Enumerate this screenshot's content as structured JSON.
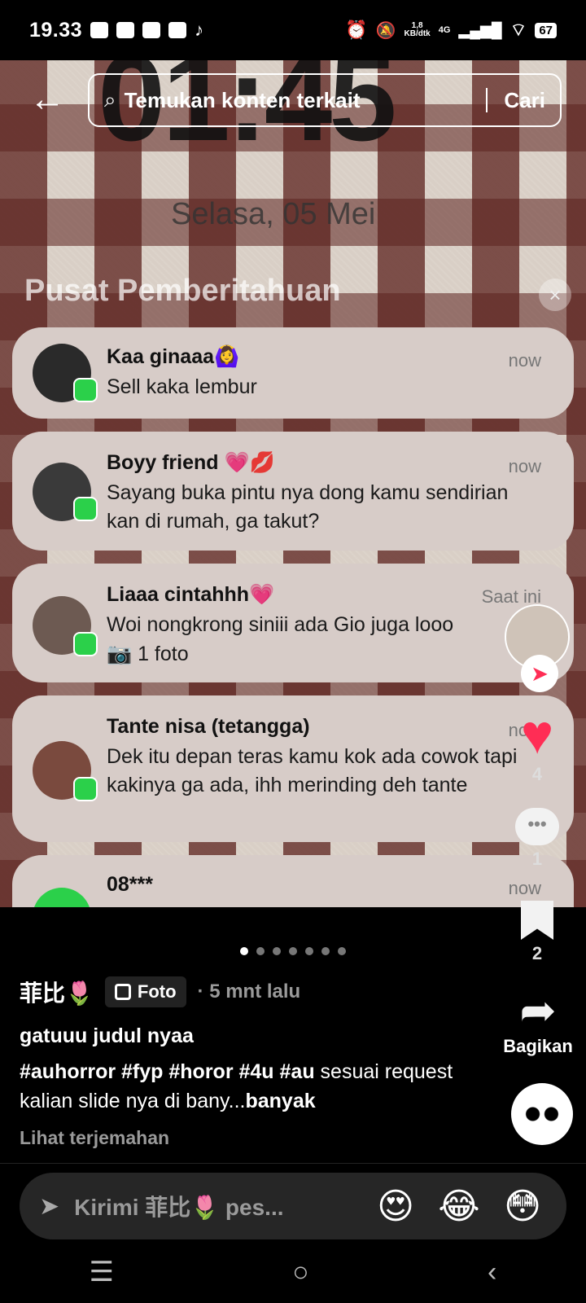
{
  "status_bar": {
    "time": "19.33",
    "net_speed": "1,8",
    "net_unit": "KB/dtk",
    "signal": "4G",
    "battery": "67"
  },
  "search": {
    "placeholder": "Temukan konten terkait",
    "button": "Cari"
  },
  "photo": {
    "lock_time": "01:45",
    "lock_date": "Selasa, 05 Mei",
    "center_title": "Pusat Pemberitahuan",
    "notifications": [
      {
        "name": "Kaa ginaaa🙆‍♀️",
        "message": "Sell kaka lembur",
        "time": "now"
      },
      {
        "name": "Boyy friend 💗💋",
        "message": "Sayang buka pintu nya dong kamu sendirian kan di rumah, ga takut?",
        "time": "now"
      },
      {
        "name": "Liaaa cintahhh💗",
        "message": "Woi nongkrong siniii ada Gio juga looo",
        "attachment": "📷 1 foto",
        "time": "Saat ini"
      },
      {
        "name": "Tante nisa (tetangga)",
        "message": "Dek itu depan teras kamu kok ada cowok tapi kakinya ga ada, ihh merinding deh tante",
        "time": "now"
      },
      {
        "name": "08***",
        "message": "",
        "time": "now"
      }
    ]
  },
  "rail": {
    "likes": "4",
    "comments": "1",
    "saves": "2",
    "share_label": "Bagikan"
  },
  "carousel": {
    "total": 7,
    "active_index": 0
  },
  "post": {
    "author": "菲比🌷",
    "type_badge": "Foto",
    "ago": "· 5 mnt lalu",
    "title": "gatuuu judul nyaa",
    "hashtags": "#auhorror #fyp #horor #4u #au",
    "description": " sesuai request kalian slide nya di bany...",
    "more": "banyak",
    "translate": "Lihat terjemahan"
  },
  "comment_bar": {
    "placeholder": "Kirimi 菲比🌷 pes...",
    "emojis": [
      "😍",
      "😂",
      "😳"
    ]
  },
  "nav": {
    "menu": "☰",
    "home": "○",
    "back": "‹"
  },
  "colors": {
    "like": "#ff2d55",
    "whatsapp": "#2bd04a",
    "notif_bg": "#d7ccc8"
  }
}
